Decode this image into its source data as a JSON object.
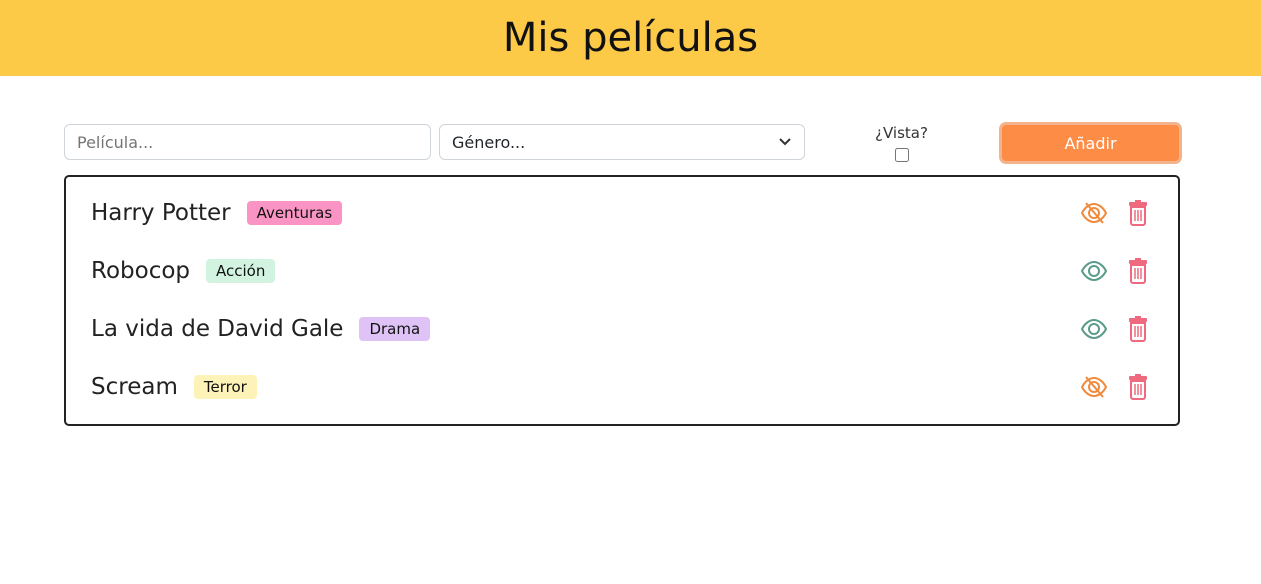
{
  "header": {
    "title": "Mis películas"
  },
  "form": {
    "movie_placeholder": "Película...",
    "genre_placeholder": "Género...",
    "seen_label": "¿Vista?",
    "seen_checked": false,
    "add_label": "Añadir"
  },
  "colors": {
    "header": "#fdca48",
    "add_button": "#fd8c47",
    "unseen_icon": "#f08a3c",
    "seen_icon": "#5a9b8a",
    "delete_icon": "#f06a7f"
  },
  "movies": [
    {
      "title": "Harry Potter",
      "genre": "Aventuras",
      "genre_color": "#fa94c4",
      "seen": false,
      "icon": "eye-off-icon"
    },
    {
      "title": "Robocop",
      "genre": "Acción",
      "genre_color": "#d2f3df",
      "seen": true,
      "icon": "eye-icon"
    },
    {
      "title": "La vida de David Gale",
      "genre": "Drama",
      "genre_color": "#dfc3f6",
      "seen": true,
      "icon": "eye-icon"
    },
    {
      "title": "Scream",
      "genre": "Terror",
      "genre_color": "#fdf2b7",
      "seen": false,
      "icon": "eye-off-icon"
    }
  ]
}
